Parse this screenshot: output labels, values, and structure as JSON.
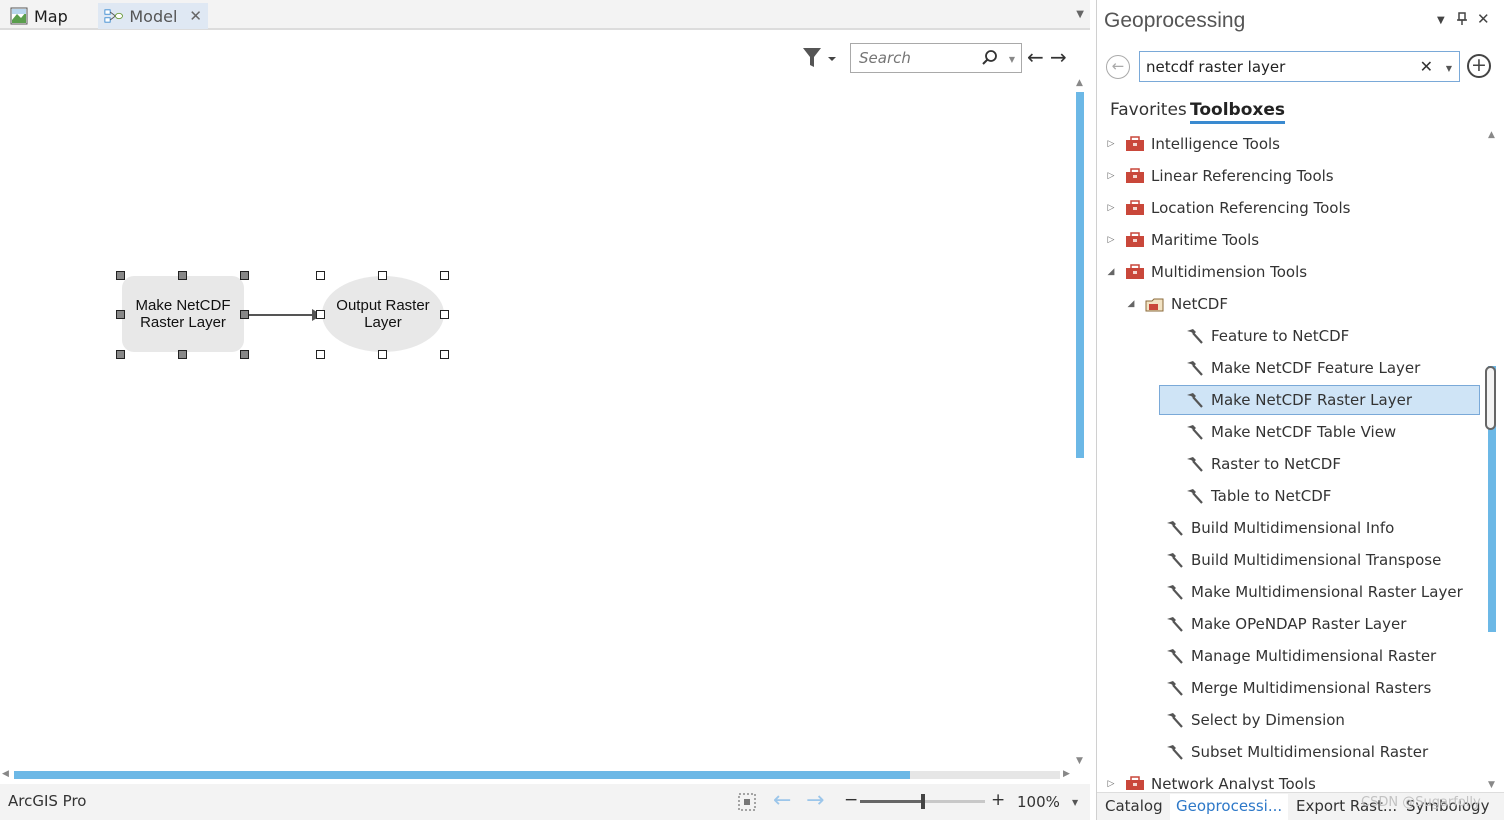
{
  "tabs": [
    {
      "label": "Map",
      "icon": "map-icon"
    },
    {
      "label": "Model",
      "icon": "model-icon"
    }
  ],
  "model_view": {
    "search": {
      "placeholder": "Search",
      "value": ""
    },
    "tool_node": {
      "label_line1": "Make NetCDF",
      "label_line2": "Raster Layer"
    },
    "output_node": {
      "label_line1": "Output Raster",
      "label_line2": "Layer"
    }
  },
  "status": {
    "app_name": "ArcGIS Pro",
    "zoom": "100%",
    "zoom_level": 0.5
  },
  "geoprocessing": {
    "title": "Geoprocessing",
    "search_value": "netcdf raster layer",
    "tabs": {
      "favorites": "Favorites",
      "toolboxes": "Toolboxes"
    },
    "tree": [
      {
        "label": "Intelligence Tools",
        "kind": "toolbox",
        "level": 0,
        "expanded": false
      },
      {
        "label": "Linear Referencing Tools",
        "kind": "toolbox",
        "level": 0,
        "expanded": false
      },
      {
        "label": "Location Referencing Tools",
        "kind": "toolbox",
        "level": 0,
        "expanded": false
      },
      {
        "label": "Maritime Tools",
        "kind": "toolbox",
        "level": 0,
        "expanded": false
      },
      {
        "label": "Multidimension Tools",
        "kind": "toolbox",
        "level": 0,
        "expanded": true
      },
      {
        "label": "NetCDF",
        "kind": "toolset",
        "level": 1,
        "expanded": true
      },
      {
        "label": "Feature to NetCDF",
        "kind": "tool",
        "level": 2
      },
      {
        "label": "Make NetCDF Feature Layer",
        "kind": "tool",
        "level": 2
      },
      {
        "label": "Make NetCDF Raster Layer",
        "kind": "tool",
        "level": 2,
        "selected": true
      },
      {
        "label": "Make NetCDF Table View",
        "kind": "tool",
        "level": 2
      },
      {
        "label": "Raster to NetCDF",
        "kind": "tool",
        "level": 2
      },
      {
        "label": "Table to NetCDF",
        "kind": "tool",
        "level": 2
      },
      {
        "label": "Build Multidimensional Info",
        "kind": "tool",
        "level": 1
      },
      {
        "label": "Build Multidimensional Transpose",
        "kind": "tool",
        "level": 1
      },
      {
        "label": "Make Multidimensional Raster Layer",
        "kind": "tool",
        "level": 1
      },
      {
        "label": "Make OPeNDAP Raster Layer",
        "kind": "tool",
        "level": 1
      },
      {
        "label": "Manage Multidimensional Raster",
        "kind": "tool",
        "level": 1
      },
      {
        "label": "Merge Multidimensional Rasters",
        "kind": "tool",
        "level": 1
      },
      {
        "label": "Select by Dimension",
        "kind": "tool",
        "level": 1
      },
      {
        "label": "Subset Multidimensional Raster",
        "kind": "tool",
        "level": 1
      },
      {
        "label": "Network Analyst Tools",
        "kind": "toolbox",
        "level": 0,
        "expanded": false
      }
    ],
    "bottom_tabs": [
      {
        "label": "Catalog",
        "active": false
      },
      {
        "label": "Geoprocessi...",
        "active": true
      },
      {
        "label": "Export Rast...",
        "active": false
      },
      {
        "label": "Symbology",
        "active": false
      }
    ],
    "watermark": "CSDN @Sugarfolly"
  },
  "colors": {
    "accent": "#3a8ad0",
    "scroll_thumb": "#6cb8e6",
    "selection": "#cfe4f6",
    "toolbox_red": "#c9473a"
  }
}
